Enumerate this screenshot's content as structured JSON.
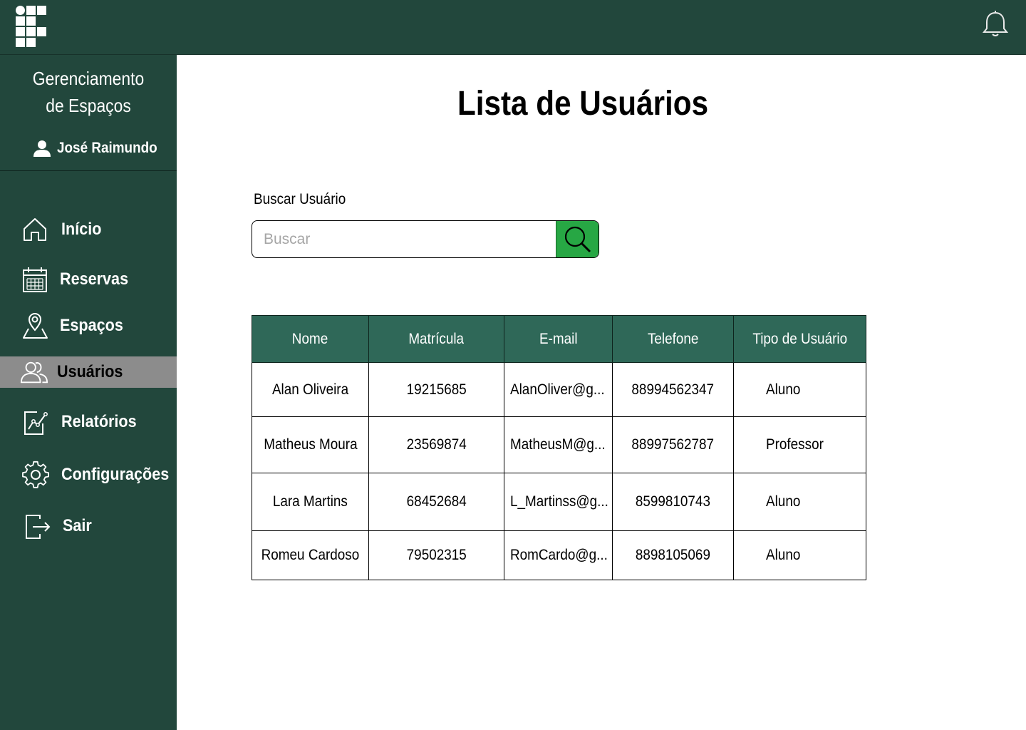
{
  "header": {
    "logo_icon": "institute-logo-icon",
    "notification_icon": "bell-icon",
    "background_color": "#22473c"
  },
  "sidebar": {
    "app_title_line1": "Gerenciamento",
    "app_title_line2": "de Espaços",
    "user_name": "José Raimundo",
    "user_icon": "person-icon",
    "items": [
      {
        "label": "Início",
        "icon": "home-icon",
        "active": false
      },
      {
        "label": "Reservas",
        "icon": "calendar-icon",
        "active": false
      },
      {
        "label": "Espaços",
        "icon": "location-pin-icon",
        "active": false
      },
      {
        "label": "Usuários",
        "icon": "users-icon",
        "active": true
      },
      {
        "label": "Relatórios",
        "icon": "chart-icon",
        "active": false
      },
      {
        "label": "Configurações",
        "icon": "gear-icon",
        "active": false
      },
      {
        "label": "Sair",
        "icon": "logout-icon",
        "active": false
      }
    ],
    "active_color": "#8c8c8c"
  },
  "main": {
    "title": "Lista de Usuários",
    "search": {
      "label": "Buscar Usuário",
      "placeholder": "Buscar",
      "value": "",
      "button_icon": "search-icon",
      "button_color": "#27a744"
    },
    "table": {
      "header_color": "#2f6858",
      "columns": [
        "Nome",
        "Matrícula",
        "E-mail",
        "Telefone",
        "Tipo de Usuário"
      ],
      "rows": [
        {
          "nome": "Alan Oliveira",
          "matricula": "19215685",
          "email": "AlanOliver@g...",
          "telefone": "88994562347",
          "tipo": "Aluno"
        },
        {
          "nome": "Matheus Moura",
          "matricula": "23569874",
          "email": "MatheusM@g...",
          "telefone": "88997562787",
          "tipo": "Professor"
        },
        {
          "nome": "Lara Martins",
          "matricula": "68452684",
          "email": "L_Martinss@g...",
          "telefone": "8599810743",
          "tipo": "Aluno"
        },
        {
          "nome": "Romeu Cardoso",
          "matricula": "79502315",
          "email": "RomCardo@g...",
          "telefone": "8898105069",
          "tipo": "Aluno"
        }
      ]
    }
  }
}
